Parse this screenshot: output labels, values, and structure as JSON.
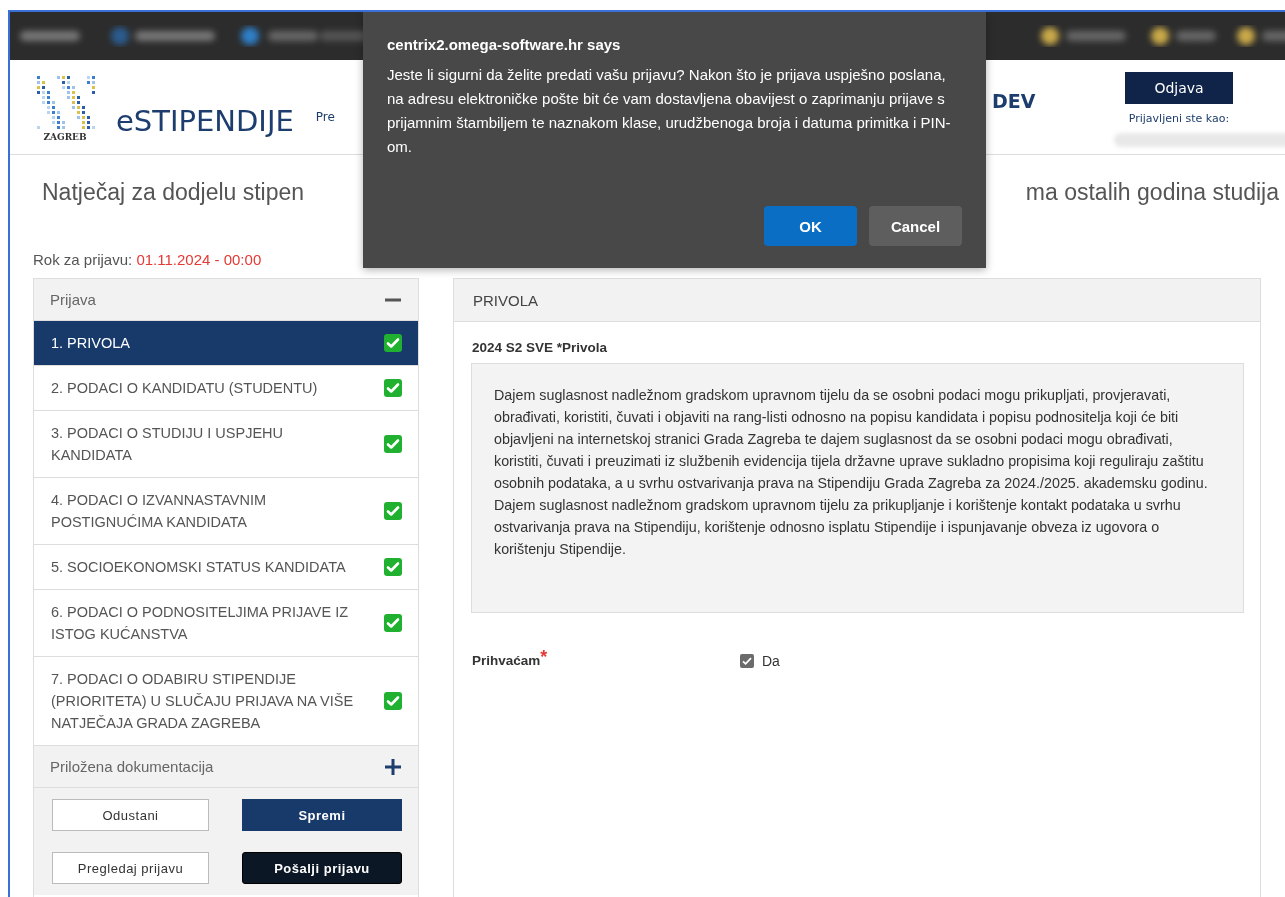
{
  "header": {
    "logo_caption": "ZAGREB",
    "app_title": "eSTIPENDIJE",
    "nav_link": "Pre",
    "env_label": "DEV",
    "logout_button": "Odjava",
    "logged_in_label": "Prijavljeni ste kao:"
  },
  "page_title": {
    "start": "Natječaj za dodjelu stipen",
    "end": "ma ostalih godina studija"
  },
  "deadline": {
    "label": "Rok za prijavu:",
    "value": "01.11.2024 - 00:00"
  },
  "sidebar": {
    "sections": [
      {
        "title": "Prijava",
        "expanded": true,
        "items": [
          {
            "label": "1. PRIVOLA",
            "selected": true,
            "completed": true
          },
          {
            "label": "2. PODACI O KANDIDATU (STUDENTU)",
            "selected": false,
            "completed": true
          },
          {
            "label": "3. PODACI O STUDIJU I USPJEHU KANDIDATA",
            "selected": false,
            "completed": true
          },
          {
            "label": "4. PODACI O IZVANNASTAVNIM POSTIGNUĆIMA KANDIDATA",
            "selected": false,
            "completed": true
          },
          {
            "label": "5. SOCIOEKONOMSKI STATUS KANDIDATA",
            "selected": false,
            "completed": true
          },
          {
            "label": "6. PODACI O PODNOSITELJIMA PRIJAVE IZ ISTOG KUĆANSTVA",
            "selected": false,
            "completed": true
          },
          {
            "label": "7. PODACI O ODABIRU STIPENDIJE (PRIORITETA) U SLUČAJU PRIJAVA NA VIŠE NATJEČAJA GRADA ZAGREBA",
            "selected": false,
            "completed": true
          }
        ]
      },
      {
        "title": "Priložena dokumentacija",
        "expanded": false
      }
    ],
    "buttons": [
      {
        "label": "Odustani",
        "kind": "outline"
      },
      {
        "label": "Spremi",
        "kind": "primary"
      },
      {
        "label": "Pregledaj prijavu",
        "kind": "outline"
      },
      {
        "label": "Pošalji prijavu",
        "kind": "dark"
      }
    ]
  },
  "content": {
    "panel_title": "PRIVOLA",
    "consent_title": "2024 S2 SVE *Privola",
    "consent_text": "Dajem suglasnost nadležnom gradskom upravnom tijelu da se osobni podaci mogu prikupljati, provjeravati, obrađivati, koristiti, čuvati i objaviti na rang-listi odnosno na popisu kandidata i popisu podnositelja koji će biti objavljeni na internetskoj stranici Grada Zagreba te dajem suglasnost da se osobni podaci mogu obrađivati, koristiti, čuvati i preuzimati iz službenih evidencija tijela državne uprave sukladno propisima koji reguliraju zaštitu osobnih podataka, a u svrhu ostvarivanja prava na Stipendiju Grada Zagreba za 2024./2025. akademsku godinu. Dajem suglasnost nadležnom gradskom upravnom tijelu za prikupljanje i korištenje kontakt podataka u svrhu ostvarivanja prava na Stipendiju, korištenje odnosno isplatu Stipendije i ispunjavanje obveza iz ugovora o korištenju Stipendije.",
    "field": {
      "label": "Prihvaćam",
      "required_mark": "*",
      "option": "Da",
      "checked": true
    }
  },
  "dialog": {
    "title": "centrix2.omega-software.hr says",
    "message": "Jeste li sigurni da želite predati vašu prijavu? Nakon što je prijava uspješno poslana, na adresu elektroničke pošte bit će vam dostavljena obavijest o zaprimanju prijave s prijamnim štambiljem te naznakom klase, urudžbenoga broja i datuma primitka i PIN-om.",
    "buttons": [
      {
        "label": "OK",
        "kind": "primary"
      },
      {
        "label": "Cancel",
        "kind": "secondary"
      }
    ]
  }
}
